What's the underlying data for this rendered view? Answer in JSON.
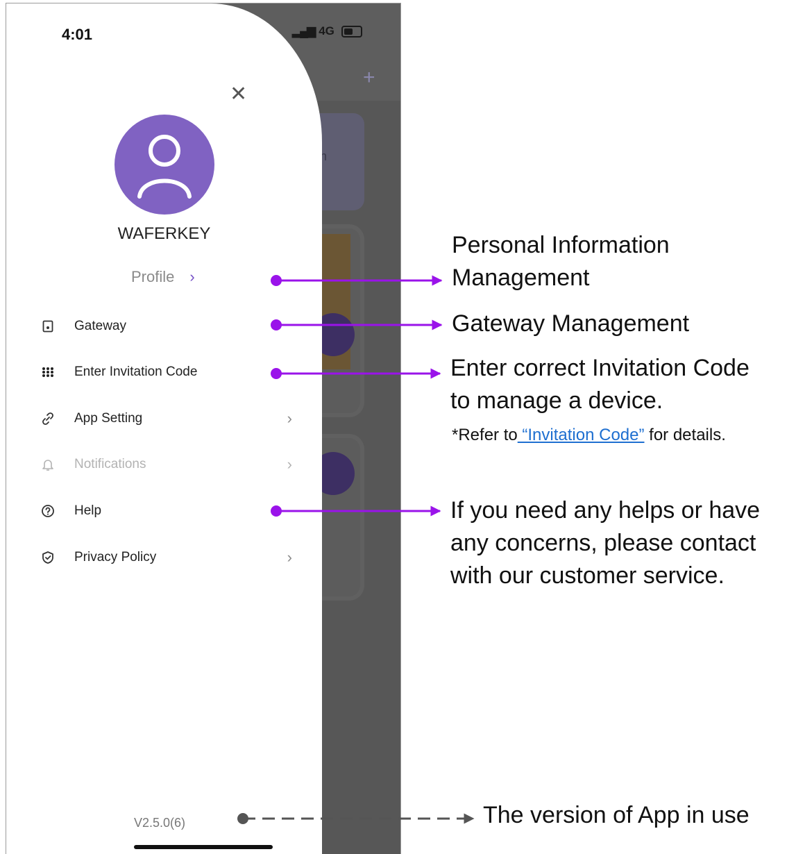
{
  "status_bar": {
    "time": "4:01",
    "network": "4G"
  },
  "drawer": {
    "username": "WAFERKEY",
    "profile_label": "Profile",
    "items": [
      {
        "label": "Gateway",
        "icon": "gateway-icon",
        "enabled": true
      },
      {
        "label": "Enter Invitation Code",
        "icon": "keypad-icon",
        "enabled": true
      },
      {
        "label": "App Setting",
        "icon": "link-icon",
        "enabled": true
      },
      {
        "label": "Notifications",
        "icon": "bell-icon",
        "enabled": false
      },
      {
        "label": "Help",
        "icon": "help-icon",
        "enabled": true
      },
      {
        "label": "Privacy Policy",
        "icon": "shield-icon",
        "enabled": true
      }
    ],
    "version": "V2.5.0(6)"
  },
  "annotations": {
    "profile_line1": "Personal Information",
    "profile_line2": "Management",
    "gateway": "Gateway Management",
    "invitation_line1": "Enter correct Invitation Code",
    "invitation_line2": "to manage a device.",
    "invitation_ref_prefix": "*Refer to",
    "invitation_ref_link": " “Invitation Code”",
    "invitation_ref_suffix": " for details.",
    "help_line1": "If you need any helps or have",
    "help_line2": "any concerns, please contact",
    "help_line3": "with our customer service.",
    "version_note": "The version of App in use"
  },
  "colors": {
    "accent": "#7550c6",
    "arrow": "#9a13ea",
    "link": "#1e6fd0"
  }
}
